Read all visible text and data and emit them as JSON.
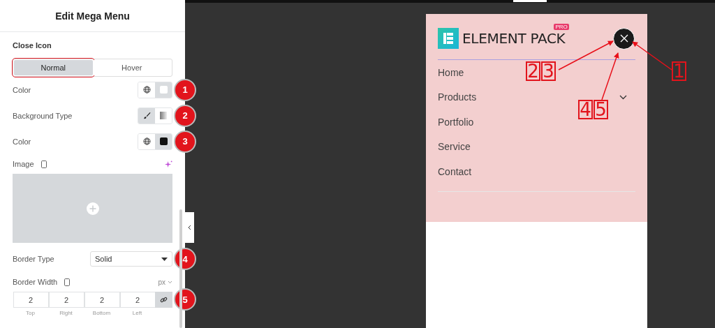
{
  "panel": {
    "title": "Edit Mega Menu",
    "section": "Close Icon",
    "tabs": [
      {
        "label": "Normal",
        "selected": true,
        "highlighted": true
      },
      {
        "label": "Hover",
        "selected": false,
        "highlighted": false
      }
    ],
    "controls": [
      {
        "kind": "color",
        "label": "Color",
        "color": "#ffffff",
        "badge": "1"
      },
      {
        "kind": "bgtype",
        "label": "Background Type",
        "badge": "2"
      },
      {
        "kind": "color",
        "label": "Color",
        "color": "#111111",
        "badge": "3"
      },
      {
        "kind": "image",
        "label": "Image"
      },
      {
        "kind": "select",
        "label": "Border Type",
        "value": "Solid",
        "badge": "4"
      },
      {
        "kind": "dimensions",
        "label": "Border Width",
        "unit": "px",
        "badge": "5",
        "fields": [
          {
            "value": "2",
            "label": "Top"
          },
          {
            "value": "2",
            "label": "Right"
          },
          {
            "value": "2",
            "label": "Bottom"
          },
          {
            "value": "2",
            "label": "Left"
          }
        ]
      }
    ]
  },
  "preview": {
    "logo": {
      "text": "ELEMENT PACK",
      "tag": "PRO"
    },
    "menu": [
      {
        "label": "Home",
        "has_submenu": false
      },
      {
        "label": "Products",
        "has_submenu": true
      },
      {
        "label": "Portfolio",
        "has_submenu": false
      },
      {
        "label": "Service",
        "has_submenu": false
      },
      {
        "label": "Contact",
        "has_submenu": false
      }
    ]
  },
  "callouts": [
    {
      "numbers": [
        "2",
        "3"
      ]
    },
    {
      "numbers": [
        "1"
      ]
    },
    {
      "numbers": [
        "4",
        "5"
      ]
    }
  ]
}
